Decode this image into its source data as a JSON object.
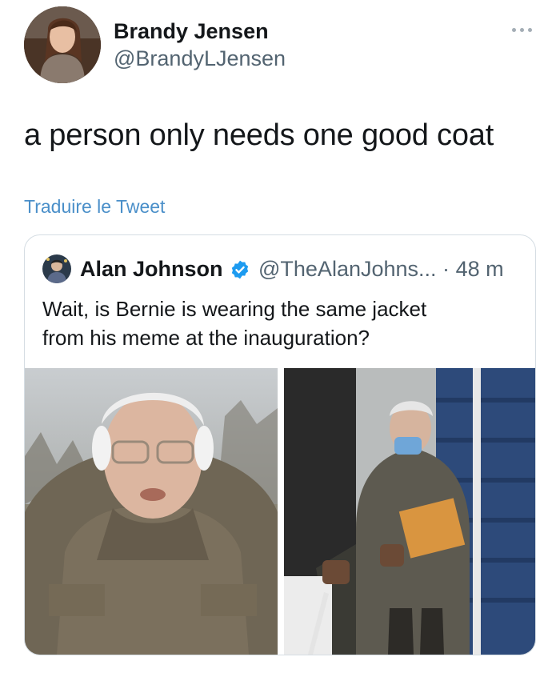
{
  "author": {
    "name": "Brandy Jensen",
    "handle": "@BrandyLJensen",
    "avatar_icon": "profile-photo"
  },
  "tweet": {
    "text": "a person only needs one good coat",
    "translate_label": "Traduire le Tweet"
  },
  "quoted_tweet": {
    "name": "Alan Johnson",
    "verified_icon": "verified-badge-icon",
    "handle": "@TheAlanJohns...",
    "separator": "·",
    "time": "48 m",
    "text_lines": [
      "Wait, is Bernie is wearing the same jacket",
      "from his meme at the inauguration?"
    ]
  },
  "colors": {
    "link": "#4a8fc9",
    "secondary_text": "#536471",
    "verified": "#1d9bf0",
    "border": "#d5dde3"
  }
}
